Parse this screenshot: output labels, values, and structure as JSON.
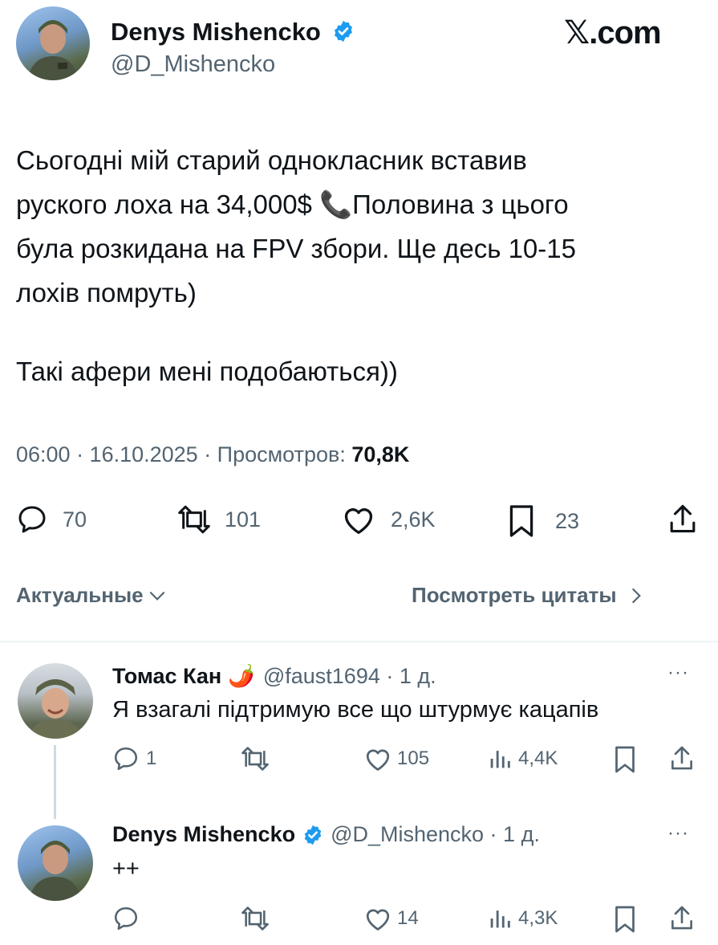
{
  "brand": {
    "logo_text": "𝕏.com"
  },
  "tweet": {
    "author_name": "Denys Mishencko",
    "author_handle": "@D_Mishencko",
    "body_lines": [
      "Сьогодні мій старий однокласник вставив",
      "руского лоха на 34,000$ 📞Половина з цього",
      "була розкидана на FPV збори. Ще десь 10-15",
      "лохів помруть)"
    ],
    "body_line2": "Такі афери мені подобаються))",
    "meta_time": "06:00 · 16.10.2025 · Просмотров: ",
    "meta_views": "70,8K",
    "stats": {
      "replies": "70",
      "retweets": "101",
      "likes": "2,6K",
      "bookmarks": "23"
    }
  },
  "sort": {
    "label": "Актуальные",
    "quotes_link": "Посмотреть цитаты"
  },
  "replies": [
    {
      "name": "Томас Кан",
      "name_emoji": "🌶️",
      "handle_time": "@faust1694 · 1 д.",
      "text": "Я взагалі підтримую все що штурмує кацапів",
      "stats": {
        "replies": "1",
        "retweets": "",
        "likes": "105",
        "views": "4,4K"
      }
    },
    {
      "name": "Denys Mishencko",
      "handle_time": "@D_Mishencko · 1 д.",
      "text": "++",
      "stats": {
        "replies": "",
        "retweets": "",
        "likes": "14",
        "views": "4,3K"
      }
    }
  ],
  "colors": {
    "verified": "#1d9bf0",
    "text": "#0f1419",
    "muted": "#536471",
    "divider": "#eff3f4"
  }
}
